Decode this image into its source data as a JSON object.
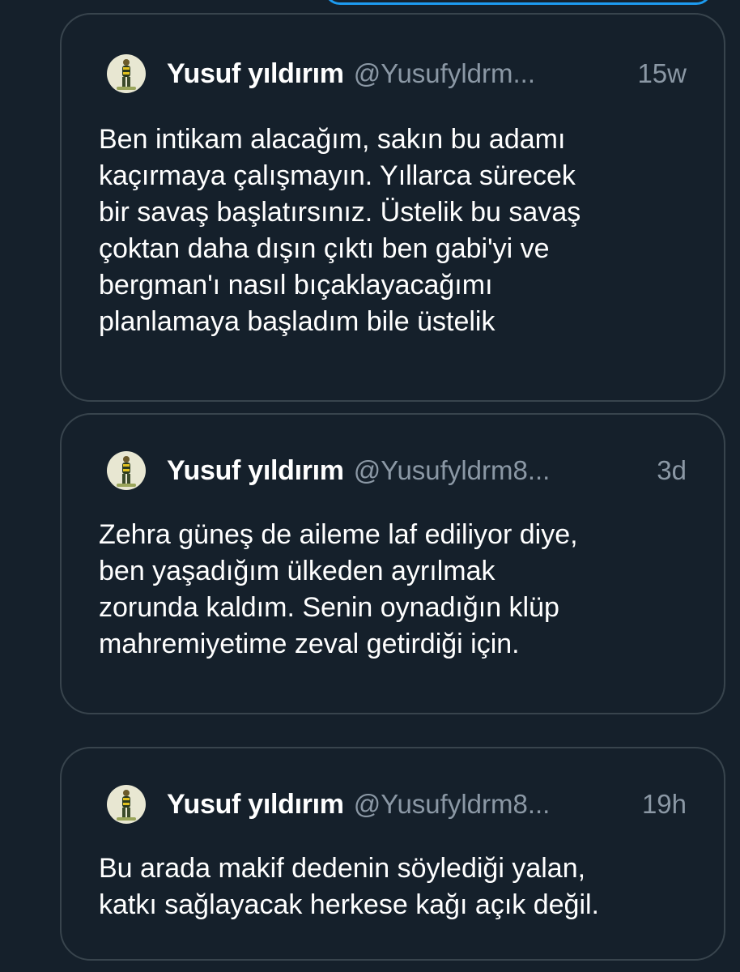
{
  "tweets": [
    {
      "name": "Yusuf yıldırım",
      "handle": "@Yusufyldrm...",
      "time": "15w",
      "avatar_icon": "user-avatar-icon",
      "text": "Ben intikam alacağım, sakın bu adamı\nkaçırmaya çalışmayın. Yıllarca sürecek\nbir savaş başlatırsınız. Üstelik bu savaş\nçoktan daha dışın çıktı ben gabi'yi ve\nbergman'ı nasıl bıçaklayacağımı\nplanlamaya başladım bile üstelik"
    },
    {
      "name": "Yusuf yıldırım",
      "handle": "@Yusufyldrm8...",
      "time": "3d",
      "avatar_icon": "user-avatar-icon",
      "text": "Zehra güneş de aileme laf ediliyor diye,\nben yaşadığım ülkeden ayrılmak\nzorunda kaldım. Senin oynadığın klüp\nmahremiyetime zeval getirdiği için."
    },
    {
      "name": "Yusuf yıldırım",
      "handle": "@Yusufyldrm8...",
      "time": "19h",
      "avatar_icon": "user-avatar-icon",
      "text": "Bu arada makif dedenin söylediği yalan,\nkatkı sağlayacak herkese kağı açık değil."
    }
  ],
  "colors": {
    "background": "#15202b",
    "card_border": "#38444d",
    "secondary_text": "#8b98a5",
    "accent": "#1d9bf0"
  }
}
